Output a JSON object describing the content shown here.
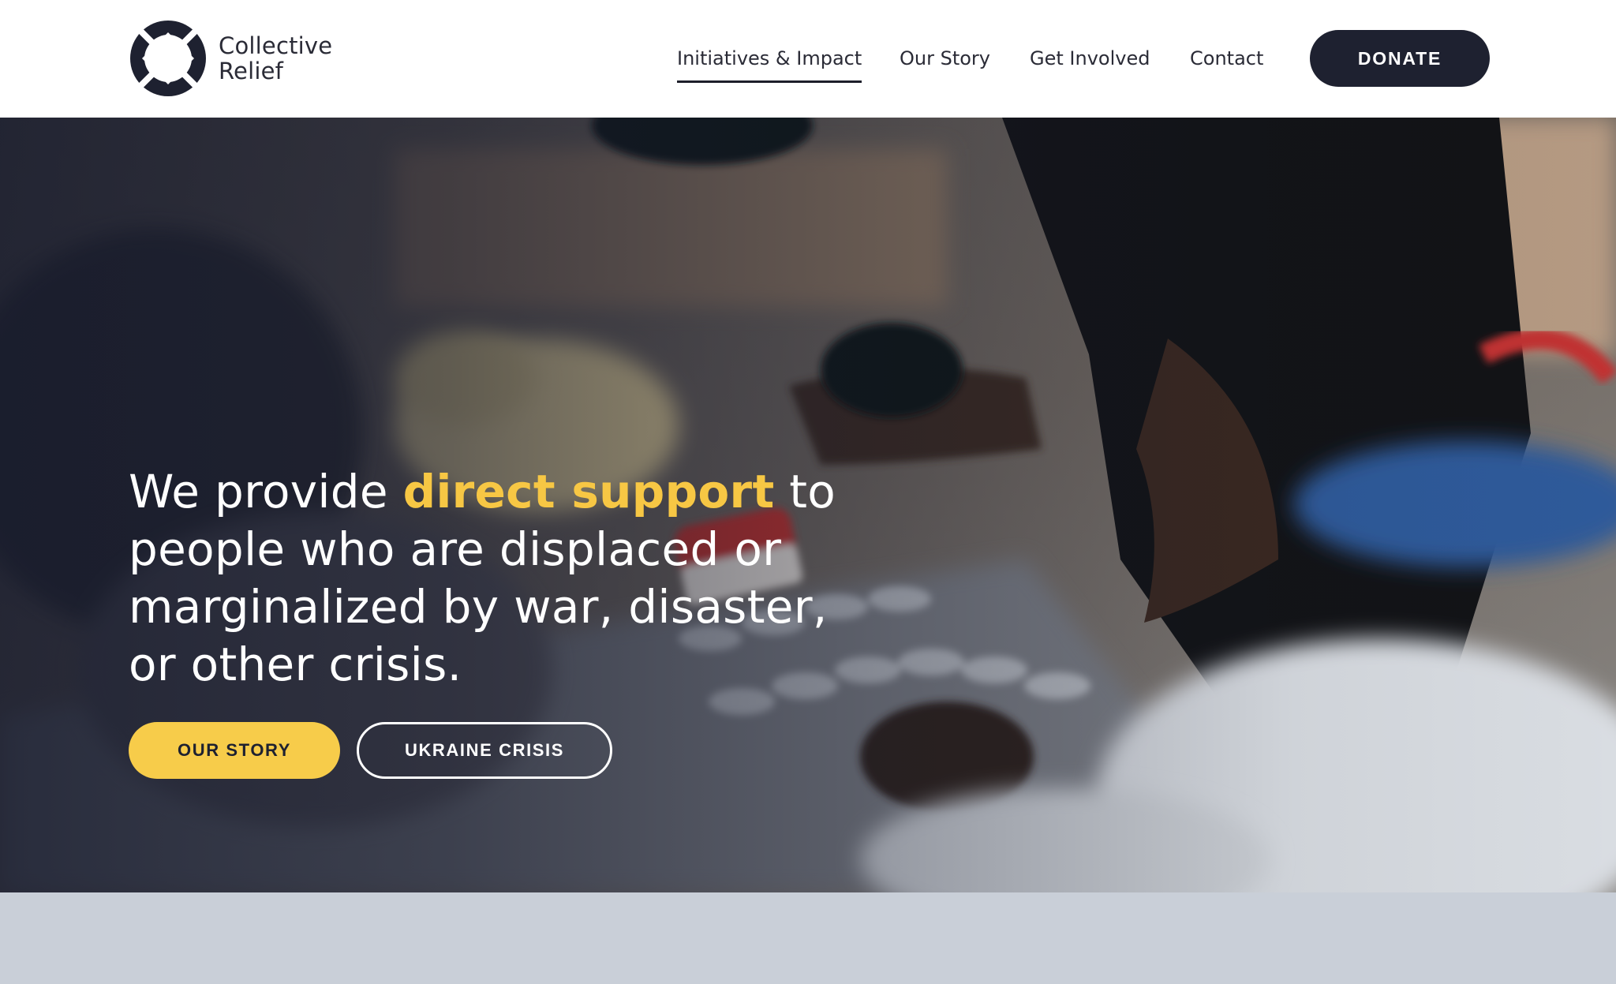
{
  "brand": {
    "line1": "Collective",
    "line2": "Relief",
    "logo_icon": "collective-relief-logo-icon"
  },
  "nav": {
    "items": [
      {
        "label": "Initiatives & Impact",
        "active": true
      },
      {
        "label": "Our Story",
        "active": false
      },
      {
        "label": "Get Involved",
        "active": false
      },
      {
        "label": "Contact",
        "active": false
      }
    ],
    "donate_label": "DONATE"
  },
  "hero": {
    "headline_before": "We provide ",
    "headline_highlight": "direct support",
    "headline_after": " to people who are displaced or marginalized by war, disaster, or other crisis.",
    "primary_button": "OUR STORY",
    "secondary_button": "UKRAINE CRISIS"
  },
  "colors": {
    "accent": "#f7cc4a",
    "dark": "#1e2130",
    "section_bg": "#c9cfd8"
  }
}
